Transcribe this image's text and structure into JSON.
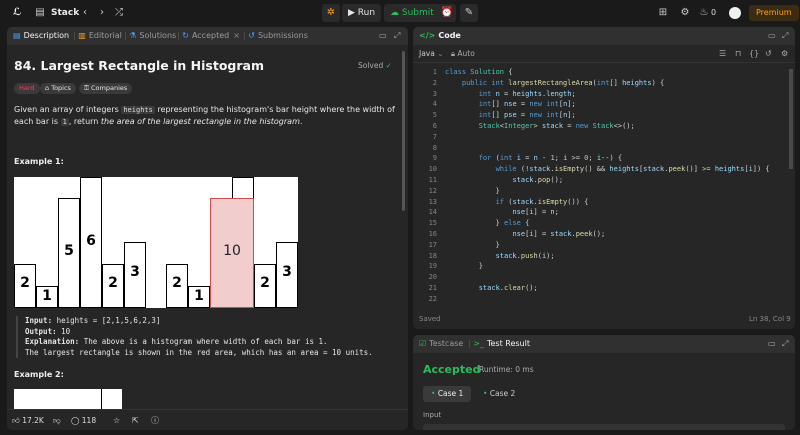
{
  "topbar": {
    "nav_title": "Stack",
    "run_label": "Run",
    "submit_label": "Submit",
    "streak_count": "0",
    "premium_label": "Premium"
  },
  "left_tabs": [
    {
      "label": "Description",
      "icon": "description-icon"
    },
    {
      "label": "Editorial",
      "icon": "editorial-icon"
    },
    {
      "label": "Solutions",
      "icon": "solutions-icon"
    },
    {
      "label": "Accepted",
      "icon": "accepted-icon"
    },
    {
      "label": "Submissions",
      "icon": "submissions-icon"
    }
  ],
  "problem": {
    "title": "84. Largest Rectangle in Histogram",
    "status": "Solved",
    "difficulty": "Hard",
    "topics_label": "Topics",
    "companies_label": "Companies",
    "desc_1": "Given an array of integers",
    "desc_code_1": "heights",
    "desc_2": "representing the histogram's bar height where the width of each bar is",
    "desc_code_2": "1",
    "desc_3": ", return",
    "desc_italic": "the area of the largest rectangle in the histogram",
    "desc_4": ".",
    "example1_label": "Example 1:",
    "example1": {
      "input_label": "Input:",
      "input_value": "heights = [2,1,5,6,2,3]",
      "output_label": "Output:",
      "output_value": "10",
      "explanation_label": "Explanation:",
      "explanation_1": "The above is a histogram where width of each bar is 1.",
      "explanation_2": "The largest rectangle is shown in the red area, which has an area = 10 units."
    },
    "example2_label": "Example 2:"
  },
  "histogram": {
    "left_bars": [
      "2",
      "1",
      "5",
      "6",
      "2",
      "3"
    ],
    "right_bars": [
      "2",
      "1",
      "",
      "",
      "2",
      "3"
    ],
    "highlight_label": "10"
  },
  "footer": {
    "likes": "17.2K",
    "comments": "118"
  },
  "code_panel": {
    "title": "Code",
    "language": "Java",
    "mode": "Auto",
    "saved": "Saved",
    "cursor": "Ln 38, Col 9"
  },
  "code_lines": [
    "class Solution {",
    "    public int largestRectangleArea(int[] heights) {",
    "        int n = heights.length;",
    "        int[] nse = new int[n];",
    "        int[] pse = new int[n];",
    "        Stack<Integer> stack = new Stack<>();",
    "",
    "",
    "        for (int i = n - 1; i >= 0; i--) {",
    "            while (!stack.isEmpty() && heights[stack.peek()] >= heights[i]) {",
    "                stack.pop();",
    "            }",
    "            if (stack.isEmpty()) {",
    "                nse[i] = n;",
    "            } else {",
    "                nse[i] = stack.peek();",
    "            }",
    "            stack.push(i);",
    "        }",
    "",
    "        stack.clear();",
    ""
  ],
  "result_panel": {
    "testcase_tab": "Testcase",
    "result_tab": "Test Result",
    "status": "Accepted",
    "runtime": "Runtime: 0 ms",
    "case1": "Case 1",
    "case2": "Case 2",
    "input_label": "Input"
  },
  "colors": {
    "accepted": "#2cbb5d",
    "hard": "#ff375f",
    "premium": "#ffa116",
    "highlight": "#f1cdcd"
  }
}
